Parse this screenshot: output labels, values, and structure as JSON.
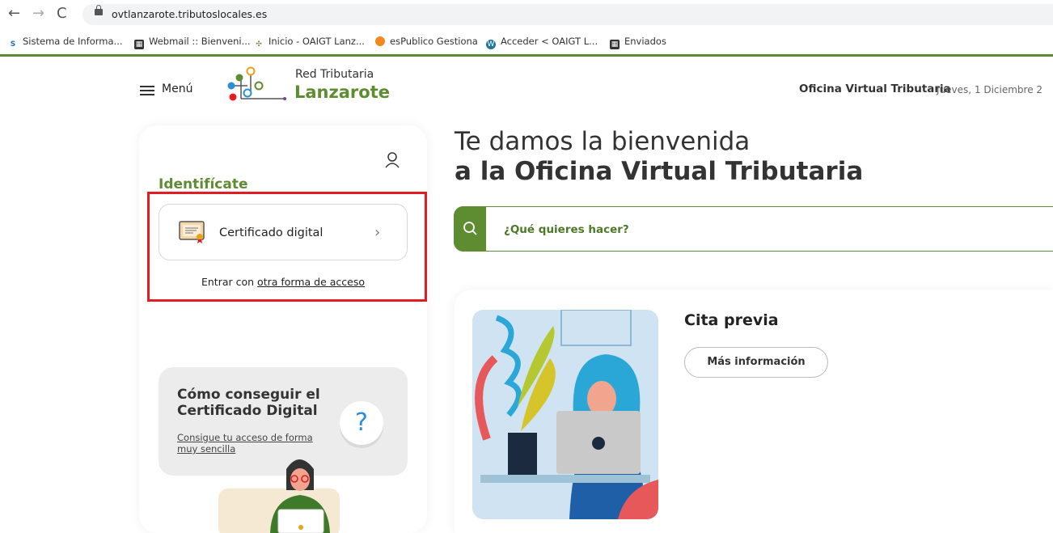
{
  "browser": {
    "url": "ovtlanzarote.tributoslocales.es",
    "bookmarks": [
      "Sistema de Informa...",
      "Webmail :: Bienveni...",
      "Inicio - OAIGT Lanz...",
      "esPublico Gestiona",
      "Acceder < OAIGT L...",
      "Enviados"
    ]
  },
  "header": {
    "menu_label": "Menú",
    "brand_top": "Red Tributaria",
    "brand_bottom": "Lanzarote",
    "office": "Oficina Virtual Tributaria",
    "date": "Jueves, 1 Diciembre 2"
  },
  "login": {
    "title": "Identifícate",
    "cert_label": "Certificado digital",
    "other_prefix": "Entrar con ",
    "other_link": "otra forma de acceso"
  },
  "howto": {
    "title_line1": "Cómo conseguir el",
    "title_line2": "Certificado Digital",
    "link": "Consigue tu acceso de forma muy sencilla"
  },
  "main": {
    "welcome_line1": "Te damos la bienvenida",
    "welcome_line2": "a la Oficina Virtual Tributaria",
    "search_label": "¿Qué quieres hacer?",
    "card_title": "Cita previa",
    "card_button": "Más información"
  },
  "colors": {
    "brand_green": "#5e8c31",
    "highlight_red": "#e31b23"
  }
}
